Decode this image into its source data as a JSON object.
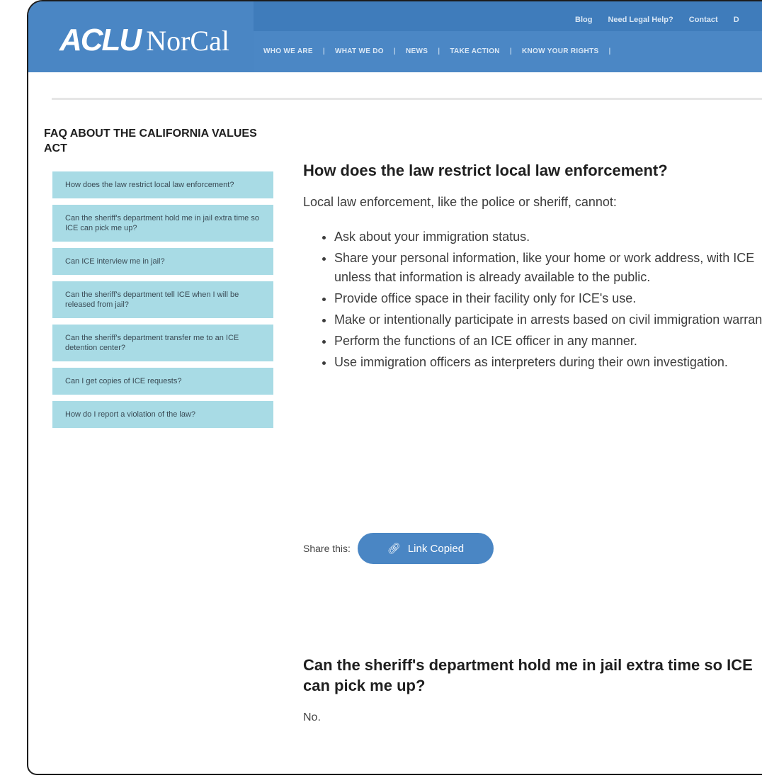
{
  "brand": {
    "logo_primary": "ACLU",
    "logo_secondary": "NorCal"
  },
  "utility_nav": [
    "Blog",
    "Need Legal Help?",
    "Contact",
    "D"
  ],
  "main_nav": [
    "WHO WE ARE",
    "WHAT WE DO",
    "NEWS",
    "TAKE ACTION",
    "KNOW YOUR RIGHTS"
  ],
  "sidebar": {
    "title": "FAQ ABOUT THE CALIFORNIA VALUES ACT",
    "items": [
      "How does the law restrict local law enforcement?",
      "Can the sheriff's department hold me in jail extra time so ICE can pick me up?",
      "Can ICE interview me in jail?",
      "Can the sheriff's department tell ICE when I will be released from jail?",
      "Can the sheriff's department transfer me to an ICE detention center?",
      "Can I get copies of ICE requests?",
      "How do I report a violation of the law?"
    ]
  },
  "question1": {
    "heading": "How does the law restrict local law enforcement?",
    "intro": "Local law enforcement, like the police or sheriff, cannot:",
    "bullets": [
      "Ask about your immigration status.",
      "Share your personal information, like your home or work address, with ICE unless that information is already available to the public.",
      "Provide office space in their facility only for ICE's use.",
      "Make or intentionally participate in arrests based on civil immigration warrants.",
      "Perform the functions of an ICE officer in any manner.",
      "Use immigration officers as interpreters during their own investigation."
    ]
  },
  "share": {
    "label": "Share this:",
    "button": "Link Copied",
    "icon": "link-icon"
  },
  "question2": {
    "heading": "Can the sheriff's department hold me in jail extra time so ICE can pick me up?",
    "answer": "No."
  },
  "colors": {
    "header_blue": "#3e7cbd",
    "sidebar_item_bg": "#a8dbe5",
    "button_blue": "#4a86c4"
  }
}
